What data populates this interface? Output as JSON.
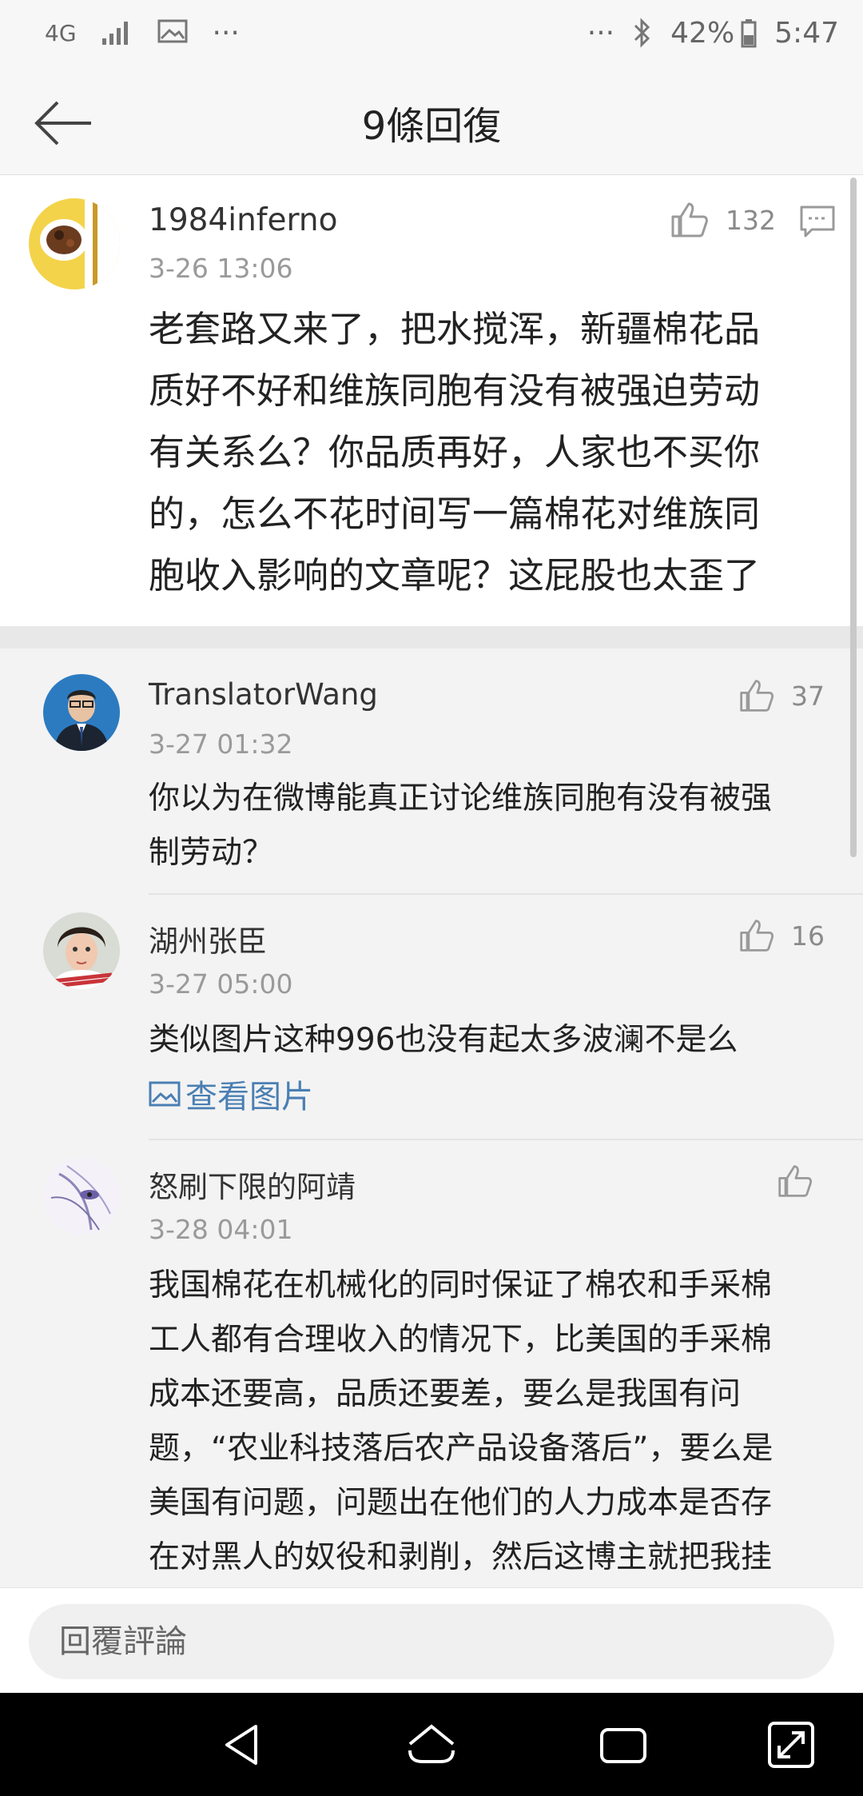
{
  "status_bar": {
    "network": "4G",
    "battery": "42%",
    "time": "5:47",
    "dots_left": "···",
    "dots_right": "···"
  },
  "header": {
    "title": "9條回復"
  },
  "main_comment": {
    "user": "1984inferno",
    "time": "3-26 13:06",
    "likes": "132",
    "lines": [
      "老套路又来了，把水搅浑，新疆棉花品",
      "质好不好和维族同胞有没有被强迫劳动",
      "有关系么？你品质再好，人家也不买你",
      "的，怎么不花时间写一篇棉花对维族同",
      "胞收入影响的文章呢？这屁股也太歪了"
    ]
  },
  "replies": [
    {
      "user": "TranslatorWang",
      "time": "3-27 01:32",
      "likes": "37",
      "lines": [
        "你以为在微博能真正讨论维族同胞有没有被强",
        "制劳动？"
      ]
    },
    {
      "user": "湖州张臣",
      "time": "3-27 05:00",
      "likes": "16",
      "lines": [
        "类似图片这种996也没有起太多波澜不是么"
      ],
      "link": "查看图片"
    },
    {
      "user": "怒刷下限的阿靖",
      "time": "3-28 04:01",
      "likes": "",
      "lines": [
        "我国棉花在机械化的同时保证了棉农和手采棉",
        "工人都有合理收入的情况下，比美国的手采棉",
        "成本还要高，品质还要差，要么是我国有问",
        "题，“农业科技落后农产品设备落后”，要么是",
        "美国有问题，问题出在他们的人力成本是否存",
        "在对黑人的奴役和剥削，然后这博主就把我挂"
      ]
    }
  ],
  "bottom": {
    "placeholder": "回覆評論"
  }
}
